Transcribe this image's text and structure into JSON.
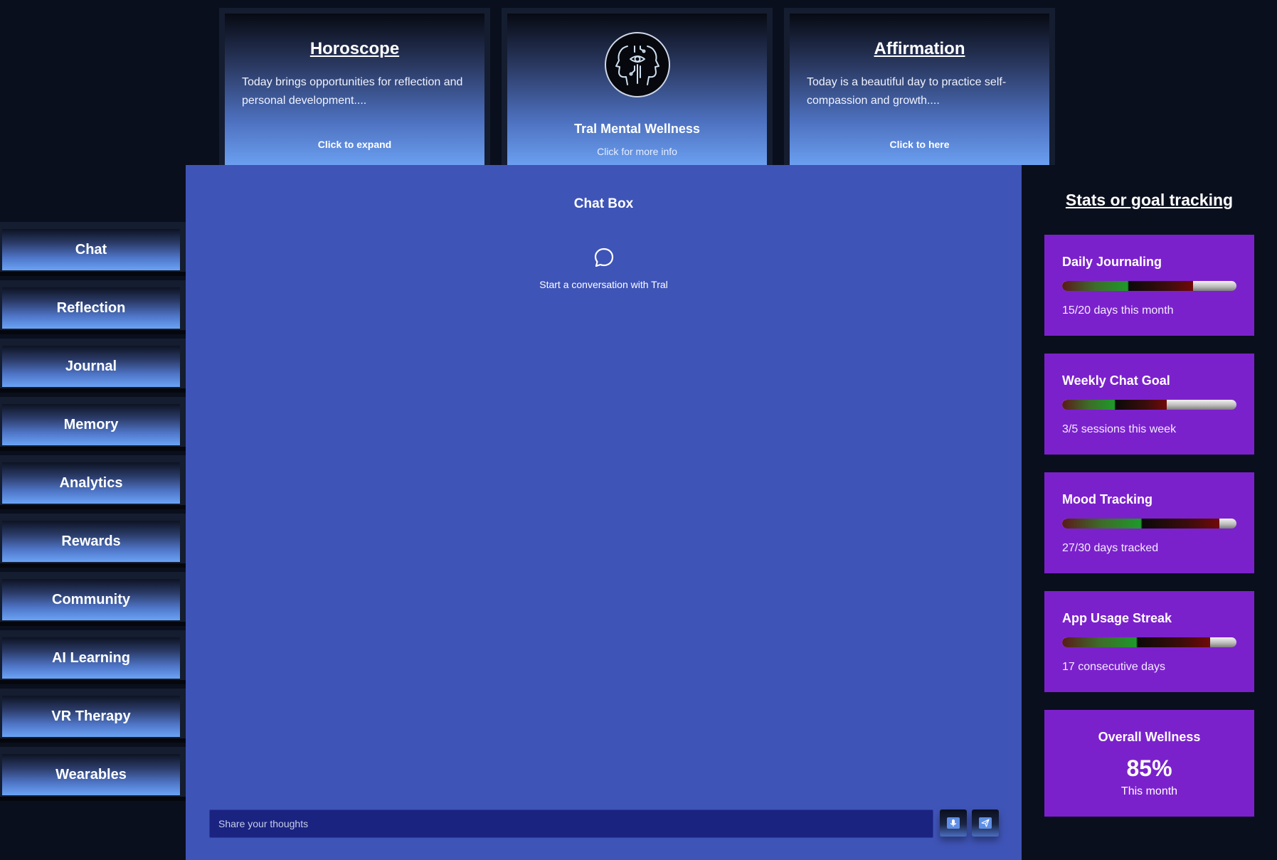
{
  "top_cards": {
    "horoscope": {
      "title": "Horoscope",
      "body": "Today brings opportunities for reflection and personal development....",
      "action": "Click to expand"
    },
    "brand": {
      "title": "Tral Mental Wellness",
      "action": "Click for more info",
      "icon": "mind-eye-logo-icon"
    },
    "affirmation": {
      "title": "Affirmation",
      "body": "Today is a beautiful day to practice self-compassion and growth....",
      "action": "Click to here"
    }
  },
  "sidebar": {
    "items": [
      {
        "label": "Chat"
      },
      {
        "label": "Reflection"
      },
      {
        "label": "Journal"
      },
      {
        "label": "Memory"
      },
      {
        "label": "Analytics"
      },
      {
        "label": "Rewards"
      },
      {
        "label": "Community"
      },
      {
        "label": "AI Learning"
      },
      {
        "label": "VR Therapy"
      },
      {
        "label": "Wearables"
      }
    ]
  },
  "chat": {
    "title": "Chat Box",
    "empty_icon": "chat-bubble-icon",
    "empty_text": "Start a conversation with Tral",
    "input_placeholder": "Share your thoughts",
    "input_value": "",
    "mic_icon": "microphone-icon",
    "send_icon": "send-icon"
  },
  "stats": {
    "title": "Stats or goal tracking",
    "cards": [
      {
        "name": "Daily Journaling",
        "detail": "15/20 days this month",
        "progress": 0.75
      },
      {
        "name": "Weekly Chat Goal",
        "detail": "3/5 sessions this week",
        "progress": 0.6
      },
      {
        "name": "Mood Tracking",
        "detail": "27/30 days tracked",
        "progress": 0.9
      },
      {
        "name": "App Usage Streak",
        "detail": "17 consecutive days",
        "progress": 0.85
      }
    ],
    "overall": {
      "title": "Overall Wellness",
      "value": "85%",
      "sub": "This month"
    }
  },
  "colors": {
    "background": "#0a0f1d",
    "chat_panel": "#3f54b7",
    "stat_card": "#7b21cc",
    "input_bg": "#1a2380"
  }
}
